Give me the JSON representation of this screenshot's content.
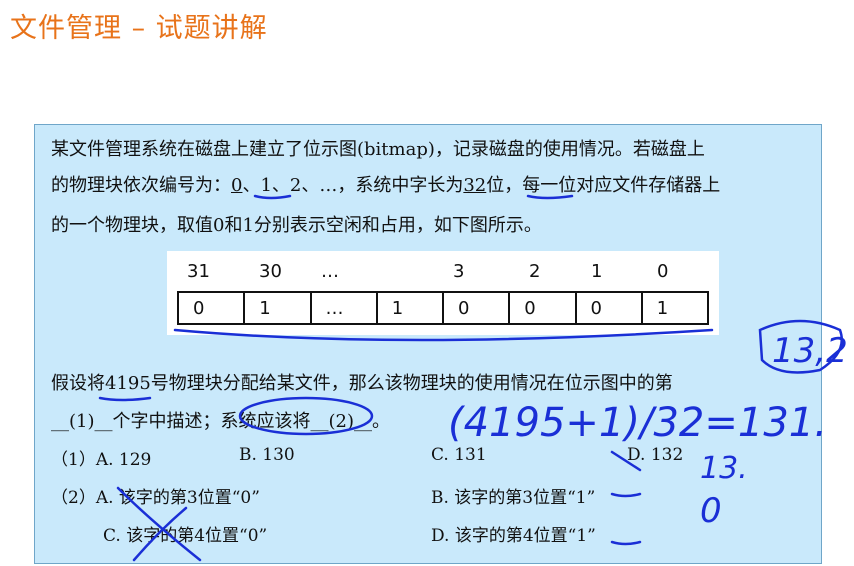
{
  "title": "文件管理 – 试题讲解",
  "question": {
    "line1": "某文件管理系统在磁盘上建立了位示图(bitmap)，记录磁盘的使用情况。若磁盘上",
    "line2_a": "的物理块依次编号为：",
    "line2_b": "0",
    "line2_c": "、1、2、…，系统中字长为",
    "line2_d": "32",
    "line2_e": "位，每一位对应文件存储器上",
    "line3": "的一个物理块，取值0和1分别表示空闲和占用，如下图所示。",
    "line4": "假设将4195号物理块分配给某文件，那么该物理块的使用情况在位示图中的第",
    "line5": "__(1)__个字中描述；系统应该将__(2)__。"
  },
  "bitmap": {
    "headers": [
      "31",
      "30",
      "…",
      "3",
      "2",
      "1",
      "0"
    ],
    "cells": [
      "0",
      "1",
      "…",
      "1",
      "0",
      "0",
      "0",
      "1"
    ]
  },
  "options": {
    "q1_label": "（1）A.  129",
    "q1_b": "B.  130",
    "q1_c": "C.  131",
    "q1_d": "D.  132",
    "q2_a": "（2）A.  该字的第3位置“0”",
    "q2_b": "B.  该字的第3位置“1”",
    "q2_c": "C.  该字的第4位置“0”",
    "q2_d": "D.  该字的第4位置“1”"
  },
  "annotations": {
    "note1": "13,2",
    "note2": "(4195+1)/32=131.",
    "note3": "13.",
    "note4": "0"
  },
  "colors": {
    "title": "#e8731a",
    "panel": "#c9e9fb",
    "ink": "#1a2fd6"
  }
}
